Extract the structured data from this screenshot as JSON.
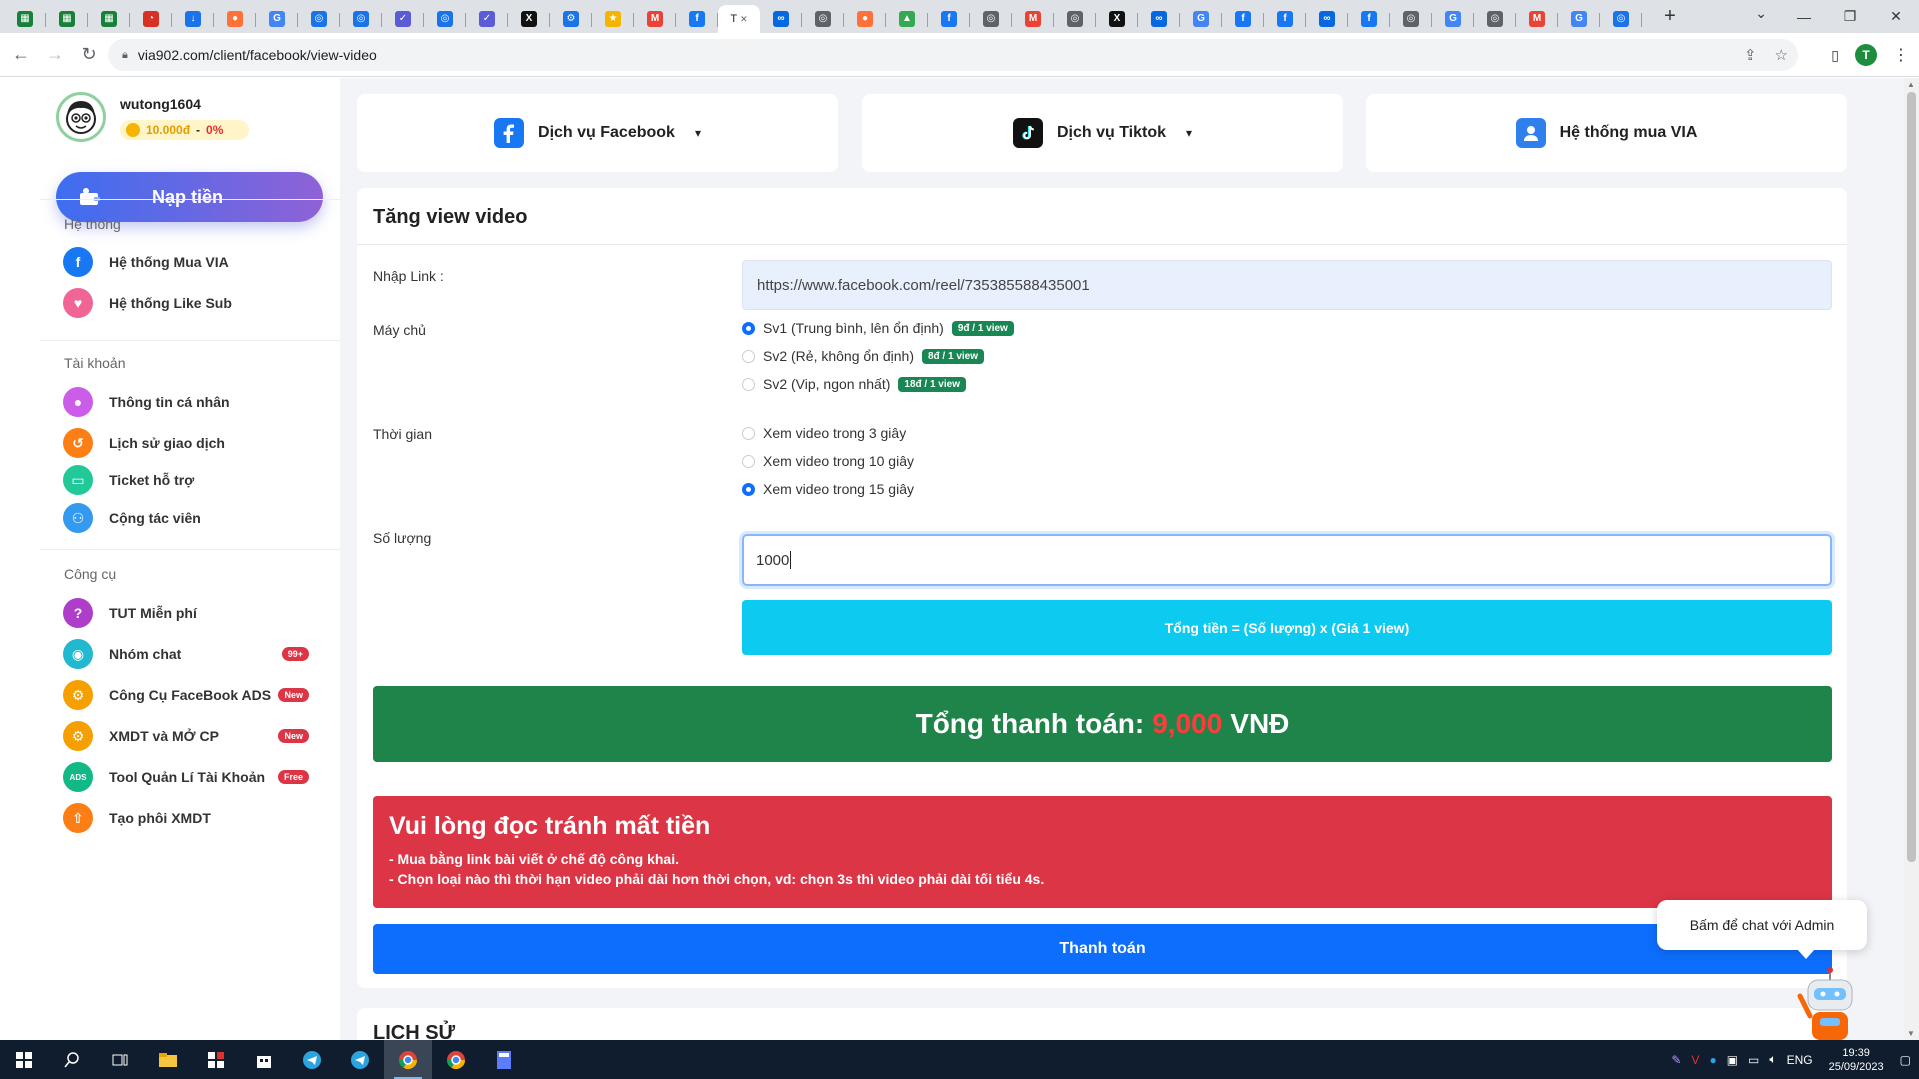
{
  "browser": {
    "active_tab_label": "T",
    "url": "via902.com/client/facebook/view-video",
    "profile_initial": "T",
    "tabs": [
      {
        "icon": "sheets-icon",
        "color": "#188038",
        "glyph": "▦"
      },
      {
        "icon": "sheets-icon",
        "color": "#188038",
        "glyph": "▦"
      },
      {
        "icon": "sheets-icon",
        "color": "#188038",
        "glyph": "▦"
      },
      {
        "icon": "speed-icon",
        "color": "#d93025",
        "glyph": "◔"
      },
      {
        "icon": "download-icon",
        "color": "#1a73e8",
        "glyph": "↓"
      },
      {
        "icon": "firefox-icon",
        "color": "#ff7139",
        "glyph": "●"
      },
      {
        "icon": "translate-icon",
        "color": "#4285f4",
        "glyph": "G"
      },
      {
        "icon": "globe-icon",
        "color": "#1a73e8",
        "glyph": "◎"
      },
      {
        "icon": "globe-icon",
        "color": "#1a73e8",
        "glyph": "◎"
      },
      {
        "icon": "shield-icon",
        "color": "#5b5bd6",
        "glyph": "✓"
      },
      {
        "icon": "globe-icon",
        "color": "#1a73e8",
        "glyph": "◎"
      },
      {
        "icon": "shield-icon",
        "color": "#5b5bd6",
        "glyph": "✓"
      },
      {
        "icon": "x-icon",
        "color": "#111111",
        "glyph": "X"
      },
      {
        "icon": "gear-icon",
        "color": "#1a73e8",
        "glyph": "⚙"
      },
      {
        "icon": "star-icon",
        "color": "#f4b400",
        "glyph": "★"
      },
      {
        "icon": "gmail-icon",
        "color": "#ea4335",
        "glyph": "M"
      },
      {
        "icon": "facebook-icon",
        "color": "#1877f2",
        "glyph": "f"
      },
      {
        "icon": "meta-icon",
        "color": "#0668e1",
        "glyph": "∞"
      },
      {
        "icon": "globe-icon",
        "color": "#5f6368",
        "glyph": "◎"
      },
      {
        "icon": "firefox-icon",
        "color": "#ff7139",
        "glyph": "●"
      },
      {
        "icon": "drive-icon",
        "color": "#34a853",
        "glyph": "▲"
      },
      {
        "icon": "facebook-icon",
        "color": "#1877f2",
        "glyph": "f"
      },
      {
        "icon": "globe-icon",
        "color": "#5f6368",
        "glyph": "◎"
      },
      {
        "icon": "gmail-icon",
        "color": "#ea4335",
        "glyph": "M"
      },
      {
        "icon": "globe-icon",
        "color": "#5f6368",
        "glyph": "◎"
      },
      {
        "icon": "x-icon",
        "color": "#111111",
        "glyph": "X"
      },
      {
        "icon": "meta-icon",
        "color": "#0668e1",
        "glyph": "∞"
      },
      {
        "icon": "google-icon",
        "color": "#4285f4",
        "glyph": "G"
      },
      {
        "icon": "facebook-icon",
        "color": "#1877f2",
        "glyph": "f"
      },
      {
        "icon": "facebook-icon",
        "color": "#1877f2",
        "glyph": "f"
      },
      {
        "icon": "meta-icon",
        "color": "#0668e1",
        "glyph": "∞"
      },
      {
        "icon": "facebook-icon",
        "color": "#1877f2",
        "glyph": "f"
      },
      {
        "icon": "globe-icon",
        "color": "#5f6368",
        "glyph": "◎"
      },
      {
        "icon": "google-icon",
        "color": "#4285f4",
        "glyph": "G"
      },
      {
        "icon": "globe-icon",
        "color": "#5f6368",
        "glyph": "◎"
      },
      {
        "icon": "gmail-icon",
        "color": "#ea4335",
        "glyph": "M"
      },
      {
        "icon": "google-icon",
        "color": "#4285f4",
        "glyph": "G"
      },
      {
        "icon": "globe-icon",
        "color": "#1a73e8",
        "glyph": "◎"
      }
    ],
    "new_tab": "+",
    "window_minimize": "—",
    "window_restore": "❐",
    "window_close": "✕"
  },
  "sidebar": {
    "username": "wutong1604",
    "balance_amount": "10.000đ",
    "balance_sep": "-",
    "balance_percent": "0%",
    "topup_label": "Nạp tiền",
    "sections": [
      {
        "title": "Hệ thống"
      },
      {
        "title": "Tài khoản"
      },
      {
        "title": "Công cụ"
      }
    ],
    "items": [
      {
        "label": "Hệ thống Mua VIA",
        "icon": "facebook-icon",
        "color": "#1877f2",
        "glyph": "f"
      },
      {
        "label": "Hệ thống Like Sub",
        "icon": "heart-icon",
        "color": "#f06595",
        "glyph": "♥"
      },
      {
        "label": "Thông tin cá nhân",
        "icon": "user-icon",
        "color": "#cc5de8",
        "glyph": "●"
      },
      {
        "label": "Lịch sử giao dịch",
        "icon": "history-icon",
        "color": "#fd7e14",
        "glyph": "↺"
      },
      {
        "label": "Ticket hỗ trợ",
        "icon": "ticket-icon",
        "color": "#20c997",
        "glyph": "▭"
      },
      {
        "label": "Cộng tác viên",
        "icon": "team-icon",
        "color": "#339af0",
        "glyph": "⚇"
      },
      {
        "label": "TUT Miễn phí",
        "icon": "question-icon",
        "color": "#ae3ec9",
        "glyph": "?"
      },
      {
        "label": "Nhóm chat",
        "icon": "chat-icon",
        "color": "#22b8cf",
        "glyph": "◉",
        "badge": "99+"
      },
      {
        "label": "Công Cụ FaceBook ADS",
        "icon": "gear-icon",
        "color": "#f59f00",
        "glyph": "⚙",
        "badge": "New"
      },
      {
        "label": "XMDT và MỞ CP",
        "icon": "gear-icon",
        "color": "#f59f00",
        "glyph": "⚙",
        "badge": "New"
      },
      {
        "label": "Tool Quản Lí Tài Khoản",
        "icon": "ads-icon",
        "color": "#12b886",
        "glyph": "ADS",
        "badge": "Free"
      },
      {
        "label": "Tạo phôi XMDT",
        "icon": "upload-icon",
        "color": "#fd7e14",
        "glyph": "⇧"
      }
    ]
  },
  "top_cards": [
    {
      "label": "Dịch vụ Facebook",
      "icon": "facebook-icon",
      "has_dropdown": true
    },
    {
      "label": "Dịch vụ Tiktok",
      "icon": "tiktok-icon",
      "has_dropdown": true
    },
    {
      "label": "Hệ thống mua VIA",
      "icon": "user-icon",
      "has_dropdown": false
    }
  ],
  "form": {
    "title": "Tăng view video",
    "link_label": "Nhập Link :",
    "link_value": "https://www.facebook.com/reel/735385588435001",
    "server_label": "Máy chủ",
    "servers": [
      {
        "label": "Sv1 (Trung bình, lên ổn định)",
        "price": "9đ / 1 view",
        "selected": true
      },
      {
        "label": "Sv2 (Rẻ, không ổn định)",
        "price": "8đ / 1 view",
        "selected": false
      },
      {
        "label": "Sv2 (Vip, ngon nhất)",
        "price": "18đ / 1 view",
        "selected": false
      }
    ],
    "time_label": "Thời gian",
    "times": [
      {
        "label": "Xem video trong 3 giây",
        "selected": false
      },
      {
        "label": "Xem video trong 10 giây",
        "selected": false
      },
      {
        "label": "Xem video trong 15 giây",
        "selected": true
      }
    ],
    "quantity_label": "Số lượng",
    "quantity_value": "1000",
    "formula_text": "Tổng tiền = (Số lượng) x (Giá 1 view)",
    "total_prefix": "Tổng thanh toán:",
    "total_amount": "9,000",
    "total_currency": "VNĐ",
    "warning_title": "Vui lòng đọc tránh mất tiền",
    "warning_lines": [
      "- Mua bằng link bài viết ở chế độ công khai.",
      "- Chọn loại nào thì thời hạn video phải dài hơn thời chọn, vd: chọn 3s thì video phải dài tối tiểu 4s."
    ],
    "pay_label": "Thanh toán"
  },
  "history_title": "LỊCH SỬ",
  "chat_popup": "Bấm để chat với Admin",
  "taskbar": {
    "language": "ENG",
    "time": "19:39",
    "date": "25/09/2023"
  }
}
